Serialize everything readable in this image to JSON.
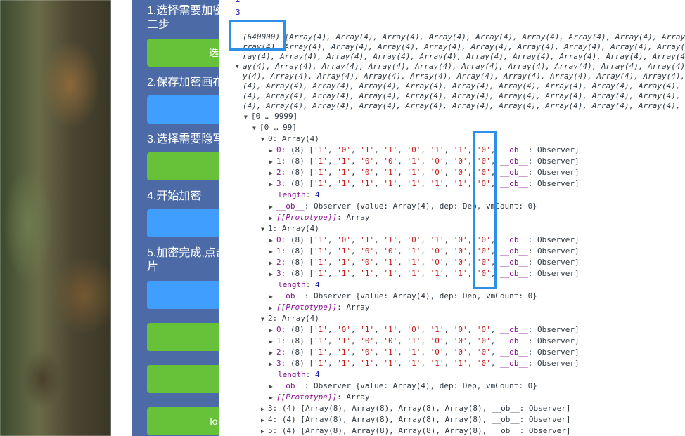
{
  "panel": {
    "steps": [
      {
        "label": "1.选择需要加密",
        "label2": "二步"
      },
      {
        "label": "2.保存加密画布"
      },
      {
        "label": "3.选择需要隐写"
      },
      {
        "label": "4.开始加密"
      },
      {
        "label": "5.加密完成,点击",
        "label2": "片"
      }
    ],
    "buttons": [
      "选",
      "",
      "",
      "",
      "",
      "",
      "",
      "lo"
    ]
  },
  "console": {
    "top_numbers": [
      "2",
      "3"
    ],
    "length_count": "(640000)",
    "summary_item": "Array(4), ",
    "wrap_prefixes": [
      "",
      "rray(4), ",
      "ray(4), ",
      "ay(4), ",
      "y(4), ",
      "(4), ",
      "(4), ",
      "(4), "
    ],
    "range_outer": "[0 … 9999]",
    "range_inner": "[0 … 99]",
    "groups": [
      {
        "label": "0: Array(4)",
        "rows": [
          [
            "'1'",
            "'0'",
            "'1'",
            "'1'",
            "'0'",
            "'1'",
            "'1'",
            "'0'"
          ],
          [
            "'1'",
            "'1'",
            "'0'",
            "'0'",
            "'1'",
            "'0'",
            "'0'",
            "'0'"
          ],
          [
            "'1'",
            "'1'",
            "'0'",
            "'1'",
            "'1'",
            "'0'",
            "'0'",
            "'0'"
          ],
          [
            "'1'",
            "'1'",
            "'1'",
            "'1'",
            "'1'",
            "'1'",
            "'1'",
            "'0'"
          ]
        ]
      },
      {
        "label": "1: Array(4)",
        "rows": [
          [
            "'1'",
            "'0'",
            "'1'",
            "'1'",
            "'0'",
            "'1'",
            "'0'",
            "'0'"
          ],
          [
            "'1'",
            "'1'",
            "'0'",
            "'0'",
            "'1'",
            "'0'",
            "'0'",
            "'0'"
          ],
          [
            "'1'",
            "'1'",
            "'0'",
            "'1'",
            "'1'",
            "'0'",
            "'0'",
            "'0'"
          ],
          [
            "'1'",
            "'1'",
            "'1'",
            "'1'",
            "'1'",
            "'1'",
            "'1'",
            "'0'"
          ]
        ]
      },
      {
        "label": "2: Array(4)",
        "rows": [
          [
            "'1'",
            "'0'",
            "'1'",
            "'1'",
            "'0'",
            "'1'",
            "'0'",
            "'0'"
          ],
          [
            "'1'",
            "'1'",
            "'0'",
            "'0'",
            "'1'",
            "'0'",
            "'0'",
            "'0'"
          ],
          [
            "'1'",
            "'1'",
            "'0'",
            "'1'",
            "'1'",
            "'0'",
            "'0'",
            "'0'"
          ],
          [
            "'1'",
            "'1'",
            "'1'",
            "'1'",
            "'1'",
            "'1'",
            "'1'",
            "'0'"
          ]
        ]
      }
    ],
    "length_label": "length",
    "length_value": "4",
    "ob_key": "__ob__",
    "observer_text": "Observer",
    "observer_detail": "Observer {value: Array(4), dep: Dep, vmCount: 0}",
    "proto_key": "[[Prototype]]",
    "proto_value": "Array",
    "collapsed": [
      "3: (4) [Array(8), Array(8), Array(8), Array(8), __ob__: Observer]",
      "4: (4) [Array(8), Array(8), Array(8), Array(8), __ob__: Observer]",
      "5: (4) [Array(8), Array(8), Array(8), Array(8), __ob__: Observer]"
    ]
  }
}
